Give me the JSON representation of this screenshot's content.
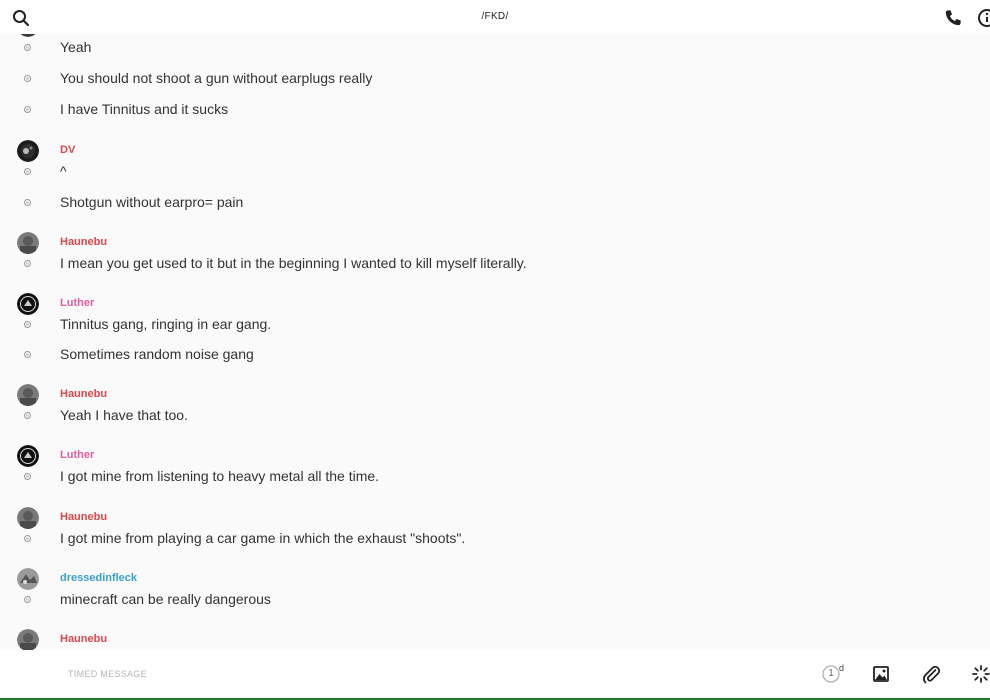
{
  "header": {
    "title": "/FKD/",
    "search_icon": "search-icon",
    "call_icon": "phone-icon",
    "info_icon": "info-icon"
  },
  "messages": [
    {
      "text": "Yeah"
    },
    {
      "text": "You should not shoot a gun without earplugs really"
    },
    {
      "text": "I have Tinnitus and it sucks"
    },
    {
      "sender": "DV",
      "text": "^"
    },
    {
      "text": "Shotgun without earpro= pain"
    },
    {
      "sender": "Haunebu",
      "text": "I mean you get used to it but in the beginning I wanted to kill myself literally."
    },
    {
      "sender": "Luther",
      "text": "Tinnitus gang, ringing in ear gang."
    },
    {
      "text": "Sometimes random noise gang"
    },
    {
      "sender": "Haunebu",
      "text": "Yeah I have that too."
    },
    {
      "sender": "Luther",
      "text": "I got mine from listening to heavy metal all the time."
    },
    {
      "sender": "Haunebu",
      "text": "I got mine from playing a car game in which the exhaust \"shoots\"."
    },
    {
      "sender": "dressedinfleck",
      "text": "minecraft can be really dangerous"
    },
    {
      "sender": "Haunebu"
    }
  ],
  "senders": {
    "DV": {
      "color": "#e0474c"
    },
    "Haunebu": {
      "color": "#e0474c"
    },
    "Luther": {
      "color": "#e45da0"
    },
    "dressedinfleck": {
      "color": "#3aa0d4"
    }
  },
  "composer": {
    "placeholder": "TIMED MESSAGE",
    "timer_value": "1",
    "timer_unit": "d",
    "image_icon": "image-icon",
    "attach_icon": "paperclip-icon",
    "loading_icon": "spinner-icon"
  },
  "colors": {
    "background": "#fafafa",
    "accent_line": "#1a7a30"
  }
}
